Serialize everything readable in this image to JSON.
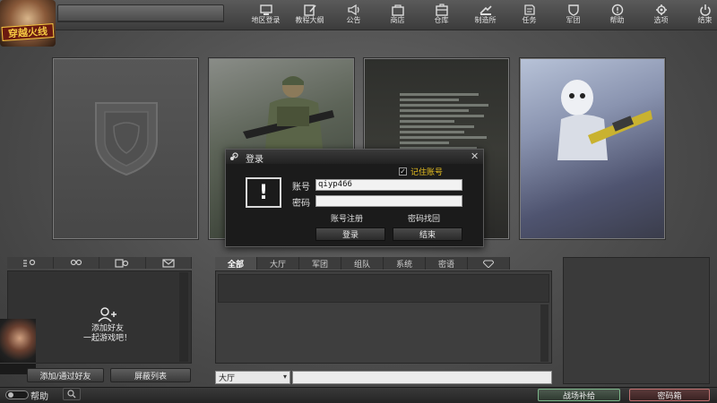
{
  "topbar": {
    "logo_text": "穿越火线",
    "nav": [
      {
        "icon": "region-login-icon",
        "label": "地区登录"
      },
      {
        "icon": "tutorial-icon",
        "label": "教程大纲"
      },
      {
        "icon": "announcement-icon",
        "label": "公告"
      },
      {
        "icon": "shop-icon",
        "label": "商店"
      },
      {
        "icon": "warehouse-icon",
        "label": "仓库"
      },
      {
        "icon": "workshop-icon",
        "label": "制造所"
      },
      {
        "icon": "mission-icon",
        "label": "任务"
      },
      {
        "icon": "clan-icon",
        "label": "军团"
      },
      {
        "icon": "help-info-icon",
        "label": "帮助"
      },
      {
        "icon": "settings-icon",
        "label": "选项"
      },
      {
        "icon": "power-icon",
        "label": "结束"
      }
    ]
  },
  "friends_panel": {
    "add_friend_text": "添加好友\n一起游戏吧！",
    "add_through_button": "添加/通过好友",
    "block_list_button": "屏蔽列表"
  },
  "chat": {
    "tabs": [
      "全部",
      "大厅",
      "军团",
      "组队",
      "系统",
      "密语"
    ],
    "active_tab": "全部",
    "channel": "大厅",
    "input_value": ""
  },
  "bottom": {
    "help_label": "帮助",
    "supply_button": "战场补给",
    "box_button": "密码箱"
  },
  "login_dialog": {
    "title": "登录",
    "remember_label": "记住账号",
    "remember_checked": true,
    "account_label": "账号",
    "account_value": "qiyp466",
    "password_label": "密码",
    "password_value": "",
    "register_link": "账号注册",
    "recover_link": "密码找回",
    "login_button": "登录",
    "exit_button": "结束",
    "close_glyph": "✕",
    "warning_glyph": "!"
  },
  "colors": {
    "remember_text": "#e8c020",
    "supply_border": "#7cb58a",
    "box_border": "#c07070"
  }
}
